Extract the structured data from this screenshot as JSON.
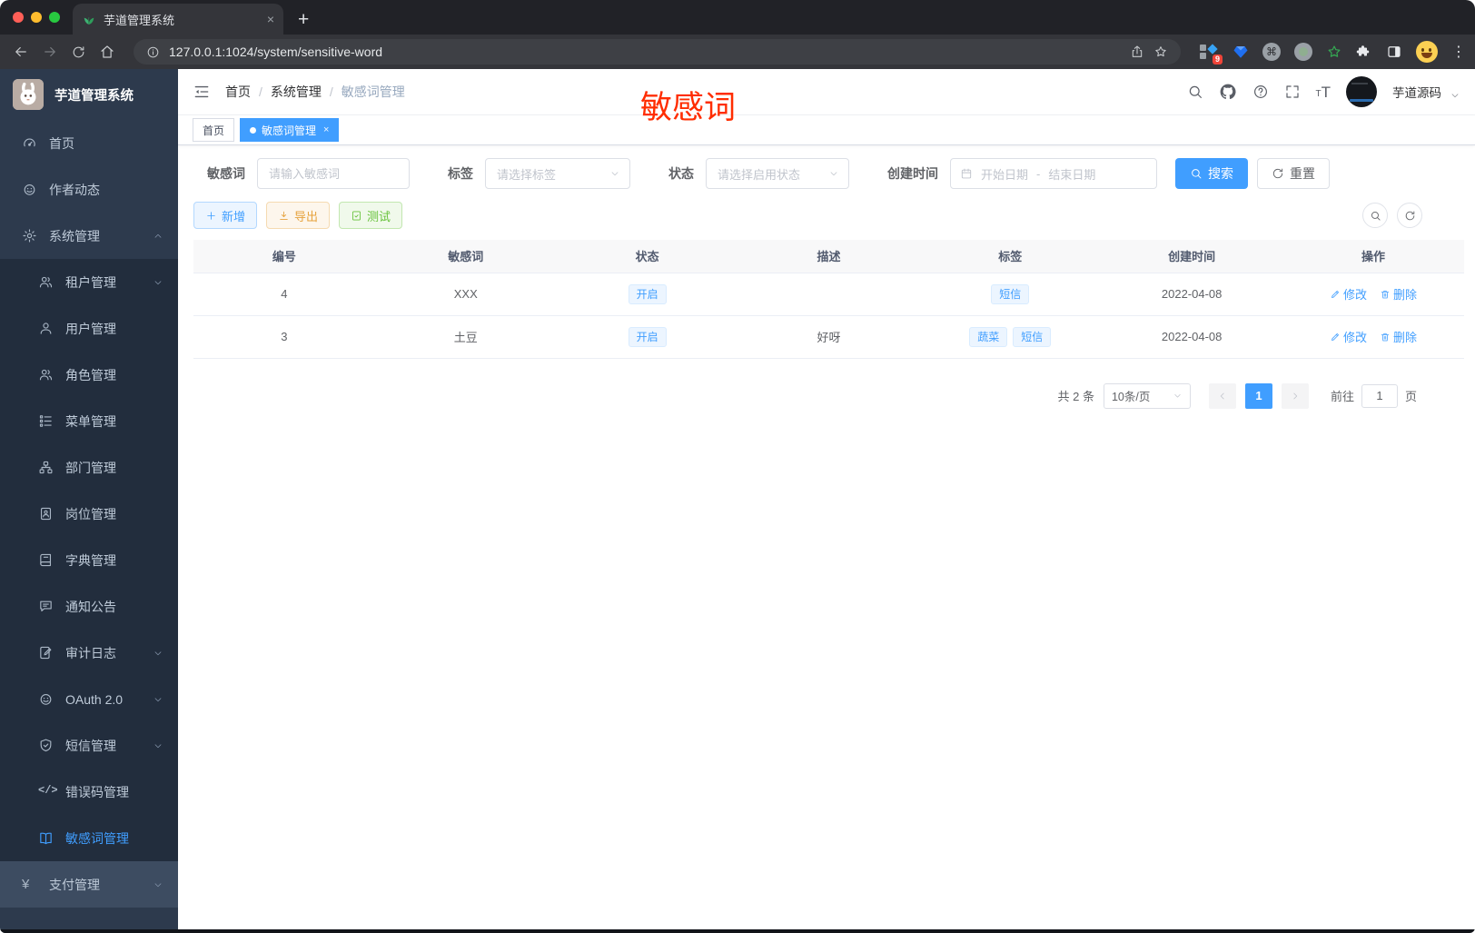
{
  "browser": {
    "tab_title": "芋道管理系统",
    "url": "127.0.0.1:1024/system/sensitive-word",
    "extension_badge": "9",
    "new_tab_label": "+"
  },
  "sidebar": {
    "logo_title": "芋道管理系统",
    "items": [
      {
        "name": "home",
        "label": "首页",
        "icon": "dashboard-icon",
        "level": 1
      },
      {
        "name": "author-feed",
        "label": "作者动态",
        "icon": "author-chat-icon",
        "level": 1
      },
      {
        "name": "system",
        "label": "系统管理",
        "icon": "gear-icon",
        "level": 1,
        "expand": "up"
      },
      {
        "name": "tenant",
        "label": "租户管理",
        "icon": "tenant-users-icon",
        "level": 2,
        "expand": "down"
      },
      {
        "name": "user",
        "label": "用户管理",
        "icon": "user-icon",
        "level": 2
      },
      {
        "name": "role",
        "label": "角色管理",
        "icon": "role-users-icon",
        "level": 2
      },
      {
        "name": "menu",
        "label": "菜单管理",
        "icon": "menu-tree-icon",
        "level": 2
      },
      {
        "name": "dept",
        "label": "部门管理",
        "icon": "org-chart-icon",
        "level": 2
      },
      {
        "name": "post",
        "label": "岗位管理",
        "icon": "id-badge-icon",
        "level": 2
      },
      {
        "name": "dict",
        "label": "字典管理",
        "icon": "book-icon",
        "level": 2
      },
      {
        "name": "notice",
        "label": "通知公告",
        "icon": "comment-icon",
        "level": 2
      },
      {
        "name": "audit-log",
        "label": "审计日志",
        "icon": "note-pen-icon",
        "level": 2,
        "expand": "down"
      },
      {
        "name": "oauth2",
        "label": "OAuth 2.0",
        "icon": "robot-icon",
        "level": 2,
        "expand": "down"
      },
      {
        "name": "sms",
        "label": "短信管理",
        "icon": "shield-check-icon",
        "level": 2,
        "expand": "down"
      },
      {
        "name": "error-code",
        "label": "错误码管理",
        "icon": "code-icon",
        "level": 2
      },
      {
        "name": "sensitive-word",
        "label": "敏感词管理",
        "icon": "open-book-icon",
        "level": 2,
        "active": true
      },
      {
        "name": "payment",
        "label": "支付管理",
        "icon": "yen-icon",
        "level": 1,
        "expand": "down",
        "highlight": true
      }
    ]
  },
  "header": {
    "breadcrumb": [
      "首页",
      "系统管理",
      "敏感词管理"
    ],
    "separator": "/",
    "annotation": "敏感词",
    "username": "芋道源码"
  },
  "tabs": [
    {
      "label": "首页",
      "active": false
    },
    {
      "label": "敏感词管理",
      "active": true
    }
  ],
  "filters": {
    "keyword_label": "敏感词",
    "keyword_placeholder": "请输入敏感词",
    "tag_label": "标签",
    "tag_placeholder": "请选择标签",
    "status_label": "状态",
    "status_placeholder": "请选择启用状态",
    "date_label": "创建时间",
    "date_start_placeholder": "开始日期",
    "date_separator": "-",
    "date_end_placeholder": "结束日期",
    "search_label": "搜索",
    "reset_label": "重置"
  },
  "toolbar": {
    "add_label": "新增",
    "export_label": "导出",
    "test_label": "测试"
  },
  "table": {
    "columns": [
      "编号",
      "敏感词",
      "状态",
      "描述",
      "标签",
      "创建时间",
      "操作"
    ],
    "rows": [
      {
        "id": "4",
        "word": "XXX",
        "status": "开启",
        "description": "",
        "tags": [
          "短信"
        ],
        "created": "2022-04-08"
      },
      {
        "id": "3",
        "word": "土豆",
        "status": "开启",
        "description": "好呀",
        "tags": [
          "蔬菜",
          "短信"
        ],
        "created": "2022-04-08"
      }
    ],
    "edit_label": "修改",
    "delete_label": "删除"
  },
  "pagination": {
    "total_text": "共 2 条",
    "page_size": "10条/页",
    "current_page": "1",
    "goto_label": "前往",
    "goto_value": "1",
    "page_label": "页"
  },
  "colors": {
    "accent": "#409eff",
    "warning": "#e6a23c",
    "success": "#67c23a",
    "annotation_red": "#ff2d00",
    "sidebar_bg": "#2d3a4d",
    "submenu_bg": "#222d3d"
  }
}
